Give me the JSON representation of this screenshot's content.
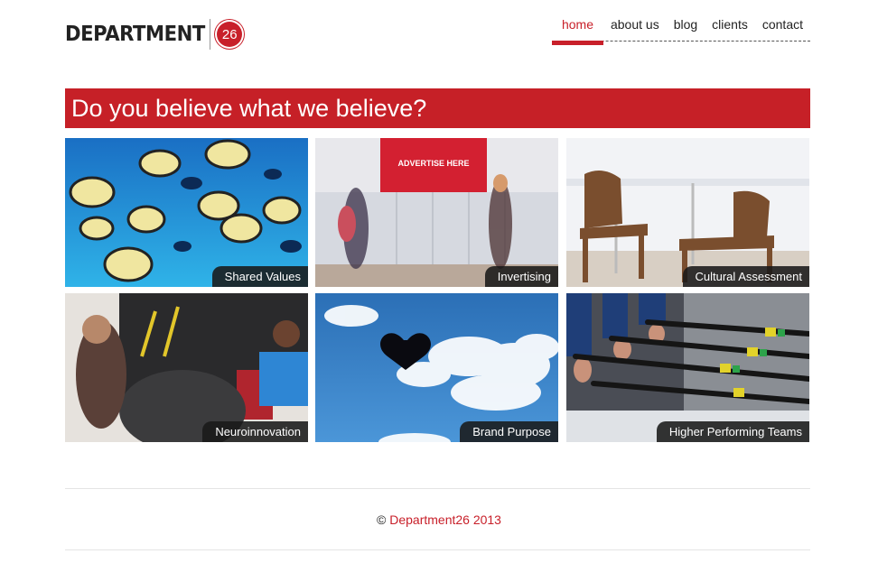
{
  "logo": {
    "wordmark": "DEPARTMENT",
    "badge": "26"
  },
  "nav": {
    "items": [
      {
        "label": "home",
        "active": true
      },
      {
        "label": "about us"
      },
      {
        "label": "blog"
      },
      {
        "label": "clients"
      },
      {
        "label": "contact"
      }
    ]
  },
  "banner": {
    "title": "Do you believe what we believe?"
  },
  "tiles": [
    {
      "label": "Shared Values"
    },
    {
      "label": "Invertising",
      "sign": "ADVERTISE HERE"
    },
    {
      "label": "Cultural Assessment"
    },
    {
      "label": "Neuroinnovation"
    },
    {
      "label": "Brand Purpose"
    },
    {
      "label": "Higher Performing Teams"
    }
  ],
  "footer": {
    "copyright_symbol": "©",
    "link": "Department26",
    "year": "2013"
  },
  "colors": {
    "brand_red": "#c62027"
  }
}
